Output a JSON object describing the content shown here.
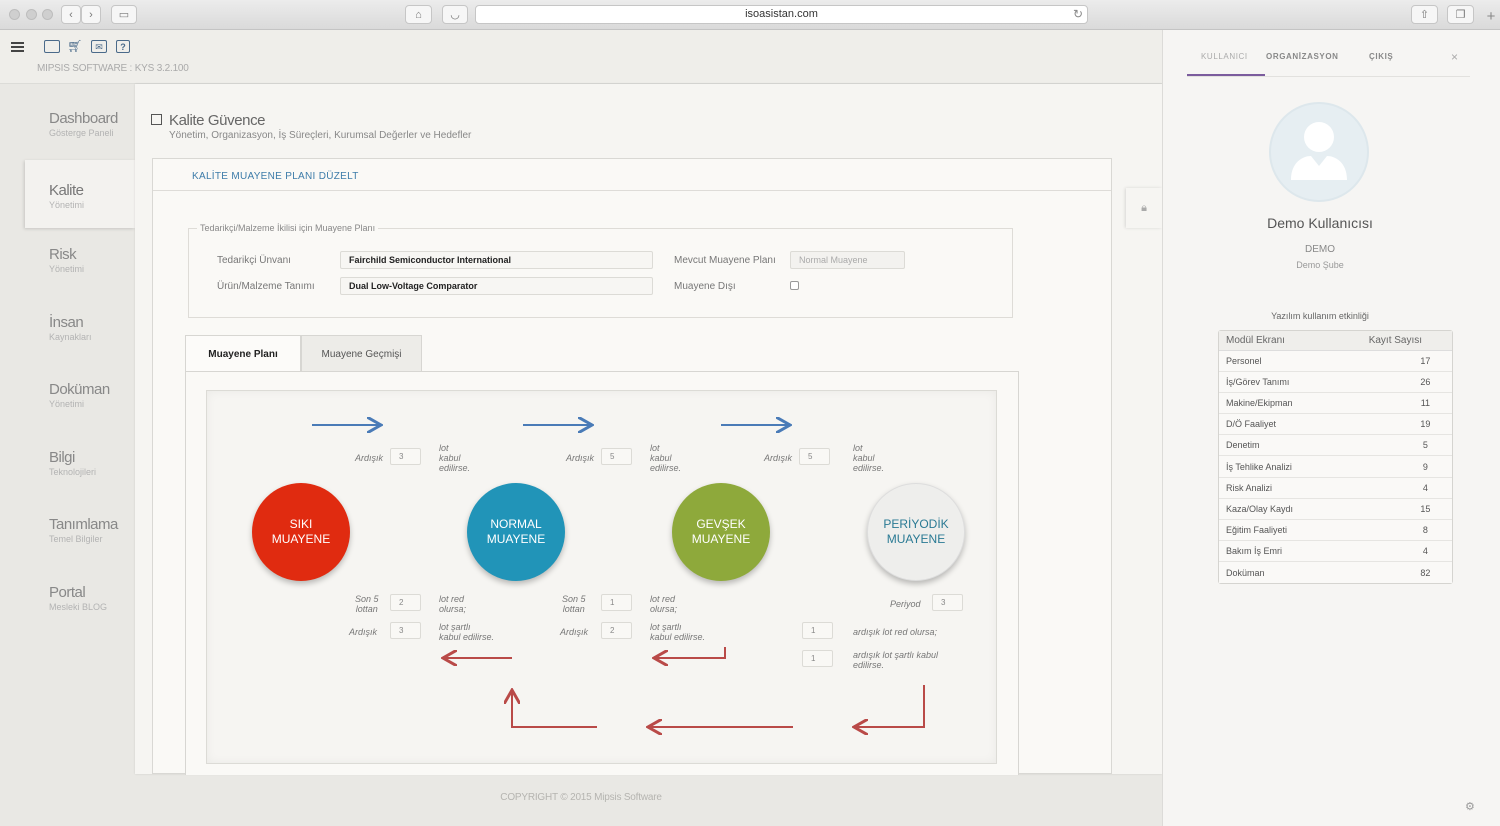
{
  "browser": {
    "url": "isoasistan.com"
  },
  "header": {
    "version": "MIPSIS SOFTWARE : KYS 3.2.100"
  },
  "sidebar": {
    "items": [
      {
        "title": "Dashboard",
        "sub": "Gösterge Paneli"
      },
      {
        "title": "Kalite",
        "sub": "Yönetimi"
      },
      {
        "title": "Risk",
        "sub": "Yönetimi"
      },
      {
        "title": "İnsan",
        "sub": "Kaynakları"
      },
      {
        "title": "Doküman",
        "sub": "Yönetimi"
      },
      {
        "title": "Bilgi",
        "sub": "Teknolojileri"
      },
      {
        "title": "Tanımlama",
        "sub": "Temel Bilgiler"
      },
      {
        "title": "Portal",
        "sub": "Mesleki BLOG"
      }
    ]
  },
  "page": {
    "title": "Kalite Güvence",
    "subtitle": "Yönetim, Organizasyon, İş Süreçleri, Kurumsal Değerler ve Hedefler",
    "card_title": "KALİTE MUAYENE PLANI DÜZELT"
  },
  "form": {
    "legend": "Tedarikçi/Malzeme İkilisi için Muayene Planı",
    "supplier_label": "Tedarikçi Ünvanı",
    "supplier_value": "Fairchild Semiconductor International",
    "product_label": "Ürün/Malzeme Tanımı",
    "product_value": "Dual Low-Voltage Comparator",
    "current_plan_label": "Mevcut Muayene Planı",
    "current_plan_value": "Normal Muayene",
    "exempt_label": "Muayene Dışı"
  },
  "tabs": {
    "plan": "Muayene Planı",
    "history": "Muayene Geçmişi"
  },
  "diagram": {
    "circles": {
      "strict": [
        "SIKI",
        "MUAYENE"
      ],
      "normal": [
        "NORMAL",
        "MUAYENE"
      ],
      "loose": [
        "GEVŞEK",
        "MUAYENE"
      ],
      "periodic": [
        "PERİYODİK",
        "MUAYENE"
      ]
    },
    "colors": {
      "strict": "#e02b10",
      "normal": "#2194b8",
      "loose": "#8ea93b",
      "periodic": "#eeeeec",
      "arrow_up": "#4a7bb7",
      "arrow_down": "#b94a48"
    },
    "labels": {
      "consecutive": "Ardışık",
      "lot_accept": [
        "lot",
        "kabul",
        "edilirse."
      ],
      "last5": [
        "Son 5",
        "lottan"
      ],
      "lot_reject": [
        "lot red",
        "olursa;"
      ],
      "lot_conditional": [
        "lot şartlı",
        "kabul edilirse."
      ],
      "period": "Periyod",
      "consec_reject": "ardışık lot red olursa;",
      "consec_conditional": [
        "ardışık lot şartlı kabul",
        "edilirse."
      ]
    },
    "values": {
      "up1": "3",
      "up2": "5",
      "up3": "5",
      "d1_last5": "2",
      "d1_cons": "3",
      "d2_last5": "1",
      "d2_cons": "2",
      "d3_a": "1",
      "d3_b": "1",
      "period": "3"
    }
  },
  "footer": "COPYRIGHT © 2015 Mipsis Software",
  "user_panel": {
    "tabs": [
      "KULLANICI",
      "ORGANİZASYON",
      "ÇIKIŞ"
    ],
    "close": "×",
    "name": "Demo Kullanıcısı",
    "company": "DEMO",
    "branch": "Demo Şube",
    "usage_title": "Yazılım kullanım etkinliği",
    "table_headers": [
      "Modül Ekranı",
      "Kayıt Sayısı"
    ],
    "rows": [
      [
        "Personel",
        "17"
      ],
      [
        "İş/Görev Tanımı",
        "26"
      ],
      [
        "Makine/Ekipman",
        "11"
      ],
      [
        "D/Ö Faaliyet",
        "19"
      ],
      [
        "Denetim",
        "5"
      ],
      [
        "İş Tehlike Analizi",
        "9"
      ],
      [
        "Risk Analizi",
        "4"
      ],
      [
        "Kaza/Olay Kaydı",
        "15"
      ],
      [
        "Eğitim Faaliyeti",
        "8"
      ],
      [
        "Bakım İş Emri",
        "4"
      ],
      [
        "Doküman",
        "82"
      ]
    ]
  }
}
